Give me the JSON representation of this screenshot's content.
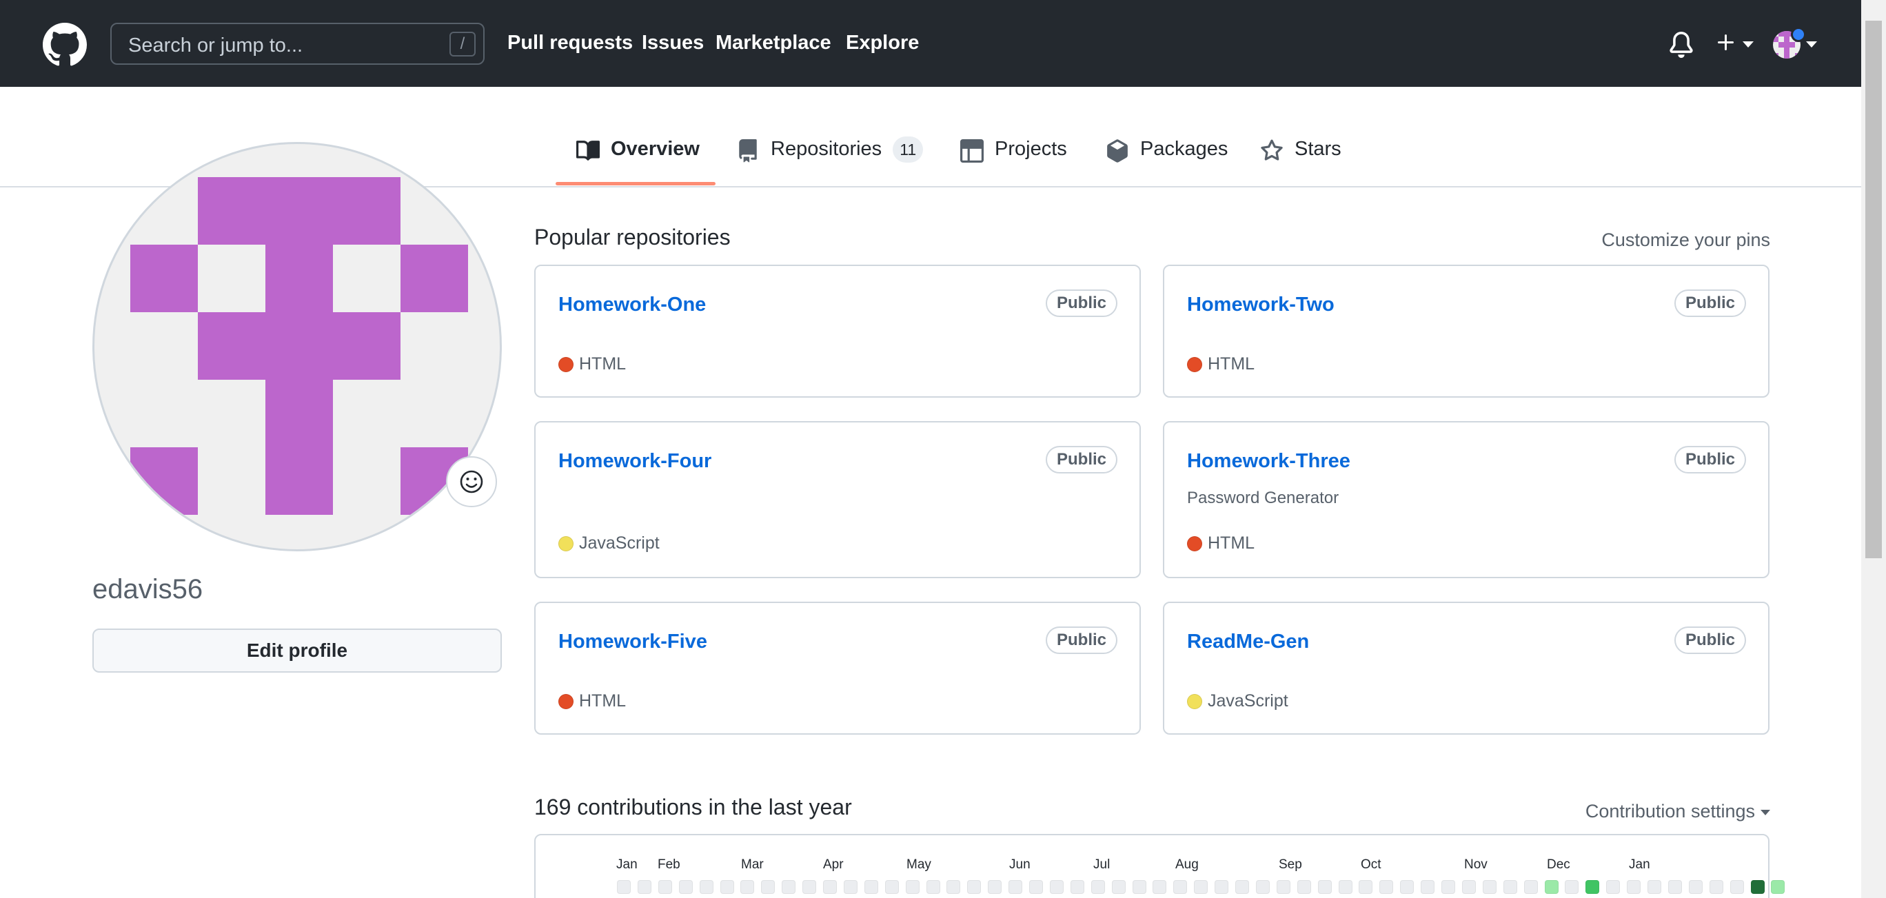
{
  "header": {
    "search_placeholder": "Search or jump to...",
    "search_shortcut": "/",
    "nav": [
      "Pull requests",
      "Issues",
      "Marketplace",
      "Explore"
    ],
    "icons": [
      "github-logo-icon",
      "bell-icon",
      "plus-icon",
      "avatar-caret-icon"
    ]
  },
  "tabs": [
    {
      "label": "Overview",
      "icon": "book-icon",
      "selected": true
    },
    {
      "label": "Repositories",
      "icon": "repo-icon",
      "count": "11"
    },
    {
      "label": "Projects",
      "icon": "table-icon"
    },
    {
      "label": "Packages",
      "icon": "package-icon"
    },
    {
      "label": "Stars",
      "icon": "star-icon"
    }
  ],
  "profile": {
    "username": "edavis56",
    "edit_label": "Edit profile",
    "avatar_color": "#bc66cc"
  },
  "pinned": {
    "title": "Popular repositories",
    "customize_label": "Customize your pins",
    "repos": [
      {
        "name": "Homework-One",
        "visibility": "Public",
        "description": "",
        "language": "HTML",
        "lang_color": "#e34c26"
      },
      {
        "name": "Homework-Two",
        "visibility": "Public",
        "description": "",
        "language": "HTML",
        "lang_color": "#e34c26"
      },
      {
        "name": "Homework-Four",
        "visibility": "Public",
        "description": "",
        "language": "JavaScript",
        "lang_color": "#f1e05a"
      },
      {
        "name": "Homework-Three",
        "visibility": "Public",
        "description": "Password Generator",
        "language": "HTML",
        "lang_color": "#e34c26"
      },
      {
        "name": "Homework-Five",
        "visibility": "Public",
        "description": "",
        "language": "HTML",
        "lang_color": "#e34c26"
      },
      {
        "name": "ReadMe-Gen",
        "visibility": "Public",
        "description": "",
        "language": "JavaScript",
        "lang_color": "#f1e05a"
      }
    ]
  },
  "contributions": {
    "title": "169 contributions in the last year",
    "settings_label": "Contribution settings",
    "months": [
      "Jan",
      "Feb",
      "Mar",
      "Apr",
      "May",
      "Jun",
      "Jul",
      "Aug",
      "Sep",
      "Oct",
      "Nov",
      "Dec",
      "Jan"
    ],
    "first_row_levels": [
      0,
      0,
      0,
      0,
      0,
      0,
      0,
      0,
      0,
      0,
      0,
      0,
      0,
      0,
      0,
      0,
      0,
      0,
      0,
      0,
      0,
      0,
      0,
      0,
      0,
      0,
      0,
      0,
      0,
      0,
      0,
      0,
      0,
      0,
      0,
      0,
      0,
      0,
      0,
      0,
      0,
      0,
      0,
      0,
      0,
      1,
      0,
      2,
      0,
      0,
      0,
      0,
      0,
      0,
      0,
      4,
      1
    ],
    "level_colors": [
      "#ebedf0",
      "#9be9a8",
      "#40c463",
      "#30a14e",
      "#216e39"
    ]
  }
}
